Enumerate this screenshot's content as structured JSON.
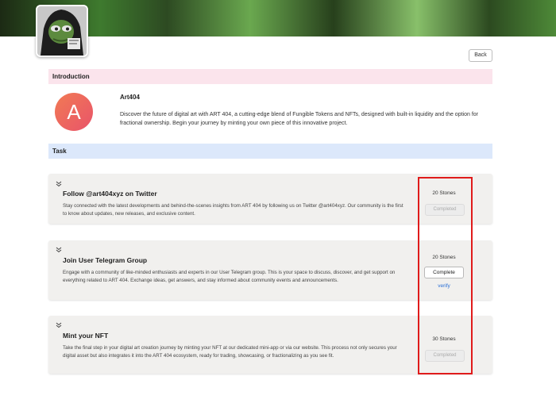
{
  "header": {
    "back_label": "Back"
  },
  "intro": {
    "section_label": "Introduction",
    "logo_letter": "A",
    "project_name": "Art404",
    "description": "Discover the future of digital art with ART 404, a cutting-edge blend of Fungible Tokens and NFTs, designed with built-in liquidity and the option for fractional ownership. Begin your journey by minting your own piece of this innovative project."
  },
  "tasks": {
    "section_label": "Task",
    "items": [
      {
        "title": "Follow @art404xyz on Twitter",
        "description": "Stay connected with the latest developments and behind-the-scenes insights from ART 404 by following us on Twitter @art404xyz. Our community is the first to know about updates, new releases, and exclusive content.",
        "reward": "20 Stones",
        "button_label": "Completed"
      },
      {
        "title": "Join User Telegram Group",
        "description": "Engage with a community of like-minded enthusiasts and experts in our User Telegram group. This is your space to discuss, discover, and get support on everything related to ART 404. Exchange ideas, get answers, and stay informed about community events and announcements.",
        "reward": "20 Stones",
        "button_label": "Complete",
        "verify_label": "verify"
      },
      {
        "title": "Mint your NFT",
        "description": "Take the final step in your digital art creation journey by minting your NFT at our dedicated mini-app or via our website. This process not only secures your digital asset but also integrates it into the ART 404 ecosystem, ready for trading, showcasing, or fractionalizing as you see fit.",
        "reward": "30 Stones",
        "button_label": "Completed"
      }
    ]
  },
  "colors": {
    "intro_bar": "#fbe4ec",
    "task_bar": "#dce8fb",
    "card_bg": "#f1f0ee",
    "link": "#2a6fd6",
    "highlight": "#e01b1b",
    "logo_gradient_start": "#f17a54",
    "logo_gradient_end": "#e9546a"
  },
  "icons": {
    "chevron": "chevron-down-icon",
    "profile": "pepe-hooded-avatar"
  }
}
